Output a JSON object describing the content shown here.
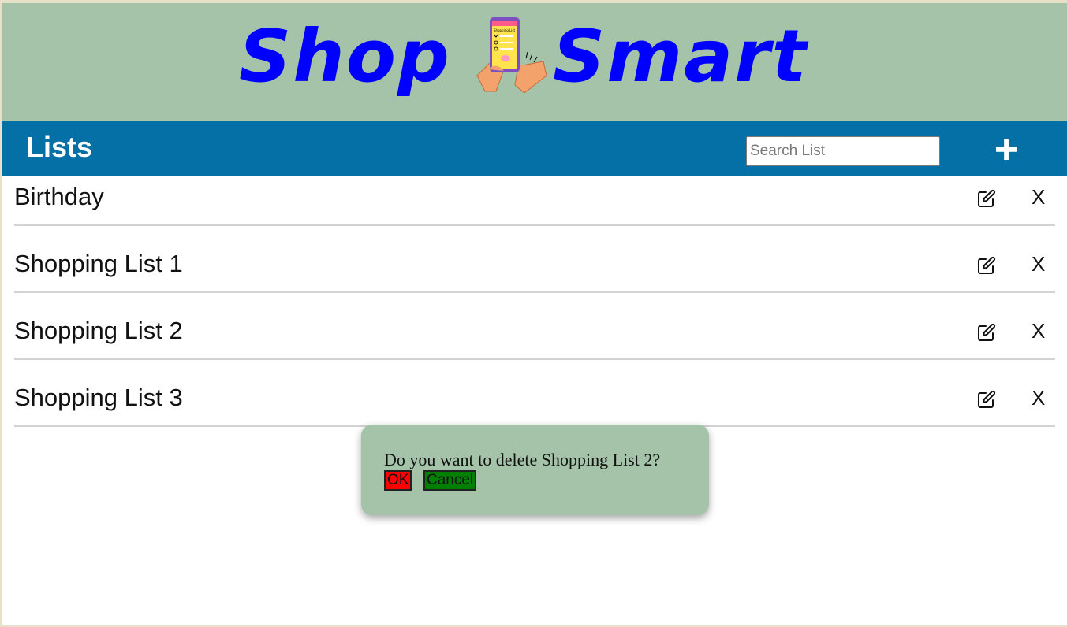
{
  "header": {
    "logo_left": "Shop",
    "logo_right": "Smart",
    "logo_phone_text": "Shopping List"
  },
  "toolbar": {
    "title": "Lists",
    "search_placeholder": "Search List",
    "add_label": "+"
  },
  "lists": [
    {
      "name": "Birthday",
      "delete_label": "X"
    },
    {
      "name": "Shopping List 1",
      "delete_label": "X"
    },
    {
      "name": "Shopping List 2",
      "delete_label": "X"
    },
    {
      "name": "Shopping List 3",
      "delete_label": "X"
    }
  ],
  "dialog": {
    "message": "Do you want to delete Shopping List 2?",
    "ok_label": "OK",
    "cancel_label": "Cancel"
  },
  "colors": {
    "banner": "#a4c3a9",
    "toolbar": "#0570a6",
    "logo_text": "#0000ff",
    "ok": "#ff0000",
    "cancel": "#008000"
  }
}
